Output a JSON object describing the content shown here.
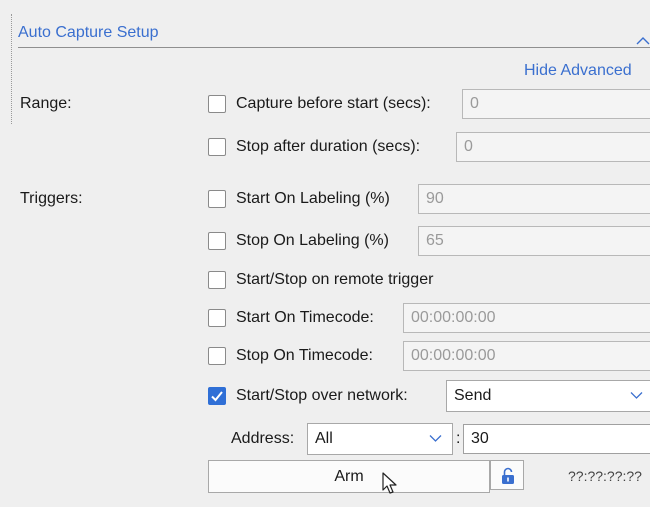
{
  "panel": {
    "title": "Auto Capture Setup",
    "hide_advanced_label": "Hide Advanced",
    "collapse_glyph": "^"
  },
  "range": {
    "label": "Range:",
    "capture_before_start": {
      "label": "Capture before start (secs):",
      "value": "0",
      "checked": false
    },
    "stop_after_duration": {
      "label": "Stop after duration (secs):",
      "value": "0",
      "checked": false
    }
  },
  "triggers": {
    "label": "Triggers:",
    "start_on_labeling": {
      "label": "Start On Labeling (%)",
      "value": "90",
      "checked": false
    },
    "stop_on_labeling": {
      "label": "Stop On Labeling (%)",
      "value": "65",
      "checked": false
    },
    "remote_trigger": {
      "label": "Start/Stop on remote trigger",
      "checked": false
    },
    "start_on_timecode": {
      "label": "Start On Timecode:",
      "value": "00:00:00:00",
      "checked": false
    },
    "stop_on_timecode": {
      "label": "Stop On Timecode:",
      "value": "00:00:00:00",
      "checked": false
    },
    "network": {
      "label": "Start/Stop over network:",
      "selected": "Send",
      "checked": true
    },
    "address": {
      "label": "Address:",
      "selected": "All",
      "separator": ":",
      "port": "30"
    }
  },
  "actions": {
    "arm_label": "Arm",
    "timecode_readout": "??:??:??:??"
  },
  "icons": {
    "chevron": "chevron-down-icon",
    "lock": "unlock-icon",
    "cursor": "mouse-cursor-icon"
  },
  "colors": {
    "accent": "#3a6fcf",
    "checkbox_checked": "#2f6fd6",
    "background": "#efefef"
  }
}
